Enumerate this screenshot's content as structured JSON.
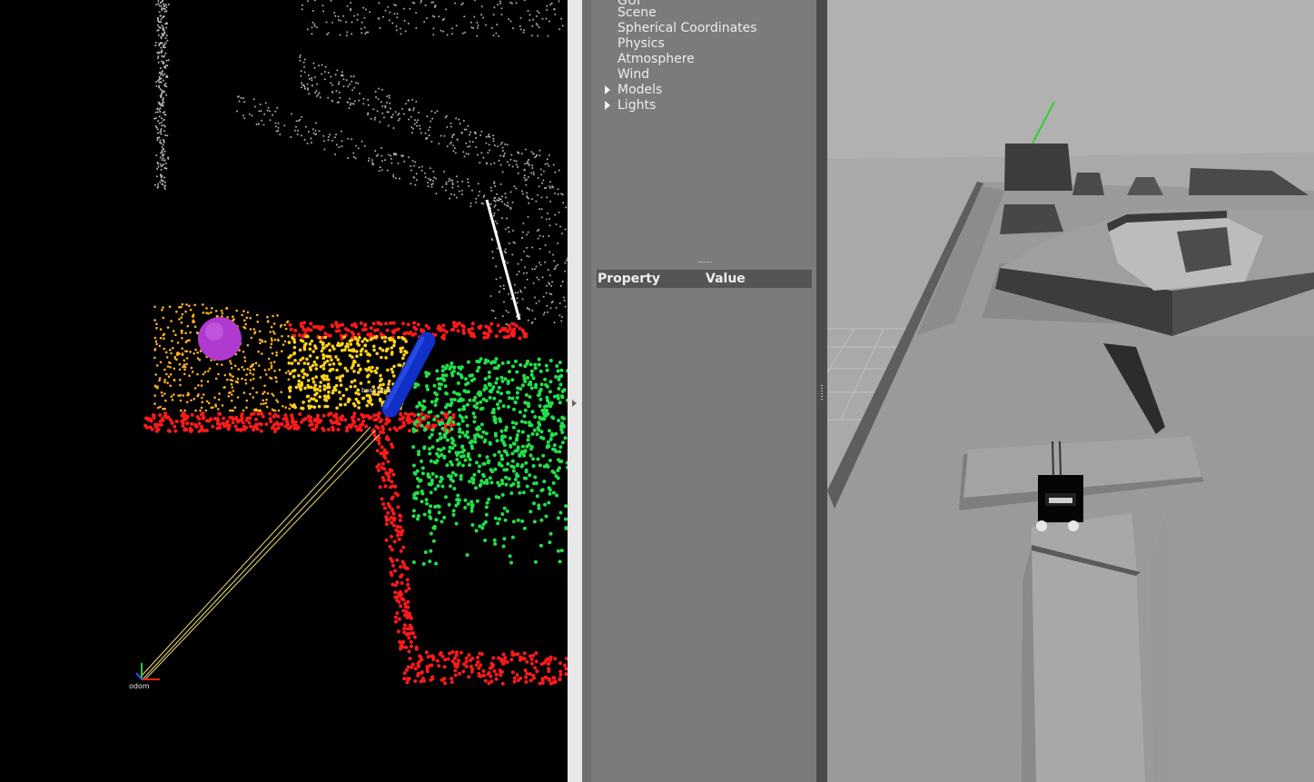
{
  "gazebo": {
    "world_tree": [
      {
        "label": "GUI",
        "expandable": false
      },
      {
        "label": "Scene",
        "expandable": false
      },
      {
        "label": "Spherical Coordinates",
        "expandable": false
      },
      {
        "label": "Physics",
        "expandable": false
      },
      {
        "label": "Atmosphere",
        "expandable": false
      },
      {
        "label": "Wind",
        "expandable": false
      },
      {
        "label": "Models",
        "expandable": true
      },
      {
        "label": "Lights",
        "expandable": true
      }
    ],
    "property_header": {
      "property": "Property",
      "value": "Value"
    }
  },
  "rviz": {
    "frame_label": "odom",
    "robot_label": "base_link",
    "colors": {
      "background": "#000000",
      "cloud_white": "#d8d8d8",
      "cloud_red": "#ff1a1a",
      "cloud_green": "#22e04a",
      "cloud_yellow": "#ffd21a",
      "cloud_orange": "#ffb020",
      "goal_sphere": "#b03ad0",
      "cylinder": "#1030c8",
      "path_line": "#f0e070"
    }
  },
  "icons": {
    "collapse": "triangle-right-icon",
    "tree_expand": "triangle-right-icon"
  }
}
